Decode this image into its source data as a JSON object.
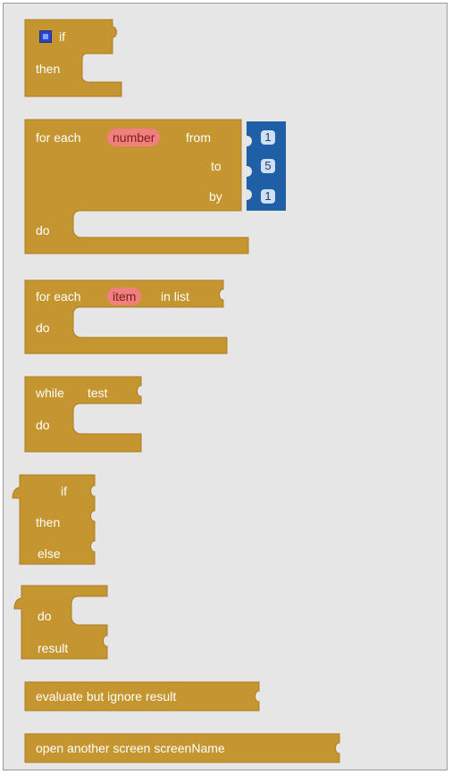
{
  "colors": {
    "control_block": "#c5952f",
    "variable": "#f08080",
    "number_block": "#1f5fa6",
    "canvas": "#e6e6e6"
  },
  "blocks": {
    "if_then": {
      "if_label": "if",
      "then_label": "then"
    },
    "for_range": {
      "for_each_label": "for each",
      "variable": "number",
      "from_label": "from",
      "from_value": "1",
      "to_label": "to",
      "to_value": "5",
      "by_label": "by",
      "by_value": "1",
      "do_label": "do"
    },
    "for_list": {
      "for_each_label": "for each",
      "variable": "item",
      "in_list_label": "in list",
      "do_label": "do"
    },
    "while": {
      "while_label": "while",
      "test_label": "test",
      "do_label": "do"
    },
    "if_expr": {
      "if_label": "if",
      "then_label": "then",
      "else_label": "else"
    },
    "do_result": {
      "do_label": "do",
      "result_label": "result"
    },
    "evaluate": {
      "label": "evaluate but ignore result"
    },
    "open_screen": {
      "label": "open another screen  screenName"
    }
  }
}
